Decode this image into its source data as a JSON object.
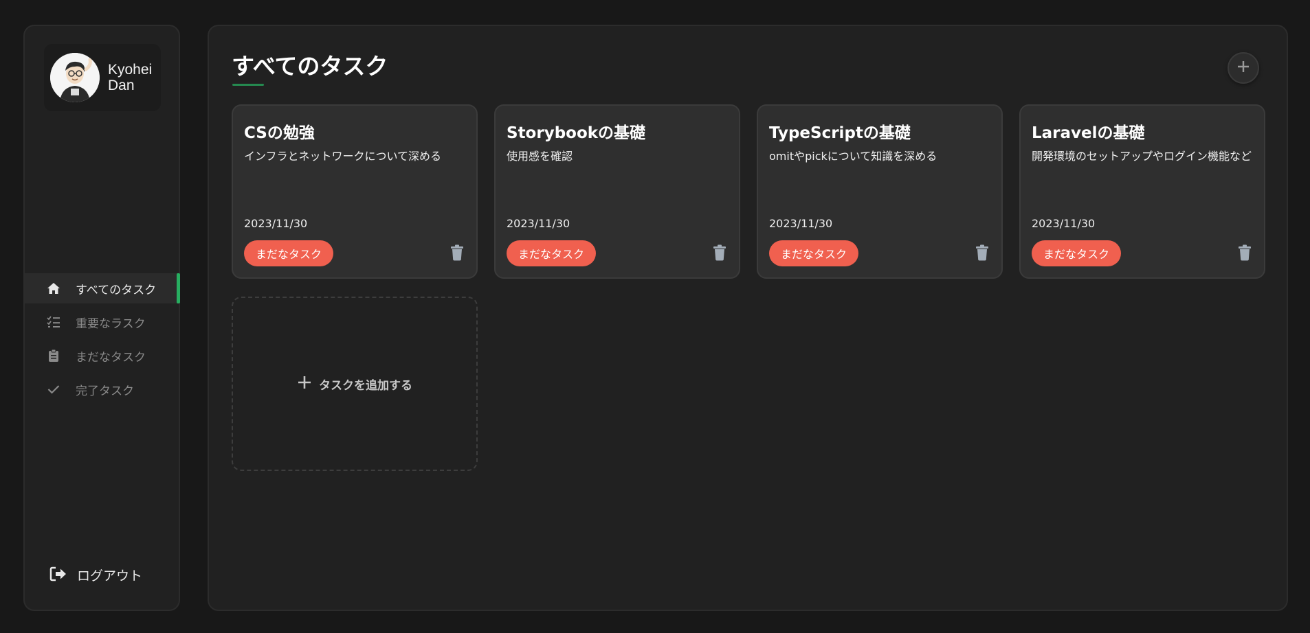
{
  "user": {
    "name": "Kyohei Dan"
  },
  "sidebar": {
    "items": [
      {
        "label": "すべてのタスク",
        "icon": "home-icon",
        "active": true
      },
      {
        "label": "重要なラスク",
        "icon": "checklist-icon",
        "active": false
      },
      {
        "label": "まだなタスク",
        "icon": "clipboard-icon",
        "active": false
      },
      {
        "label": "完了タスク",
        "icon": "check-icon",
        "active": false
      }
    ],
    "logout_label": "ログアウト"
  },
  "main": {
    "title": "すべてのタスク",
    "tasks": [
      {
        "title": "CSの勉強",
        "description": "インフラとネットワークについて深める",
        "date": "2023/11/30",
        "status": "まだなタスク"
      },
      {
        "title": "Storybookの基礎",
        "description": "使用感を確認",
        "date": "2023/11/30",
        "status": "まだなタスク"
      },
      {
        "title": "TypeScriptの基礎",
        "description": "omitやpickについて知識を深める",
        "date": "2023/11/30",
        "status": "まだなタスク"
      },
      {
        "title": "Laravelの基礎",
        "description": "開発環境のセットアップやログイン機能など",
        "date": "2023/11/30",
        "status": "まだなタスク"
      }
    ],
    "add_task_label": "タスクを追加する"
  },
  "colors": {
    "accent": "#27ae60",
    "status_pending": "#f0604f",
    "background": "#181818",
    "panel": "#212121",
    "card": "#2f2f2f"
  }
}
